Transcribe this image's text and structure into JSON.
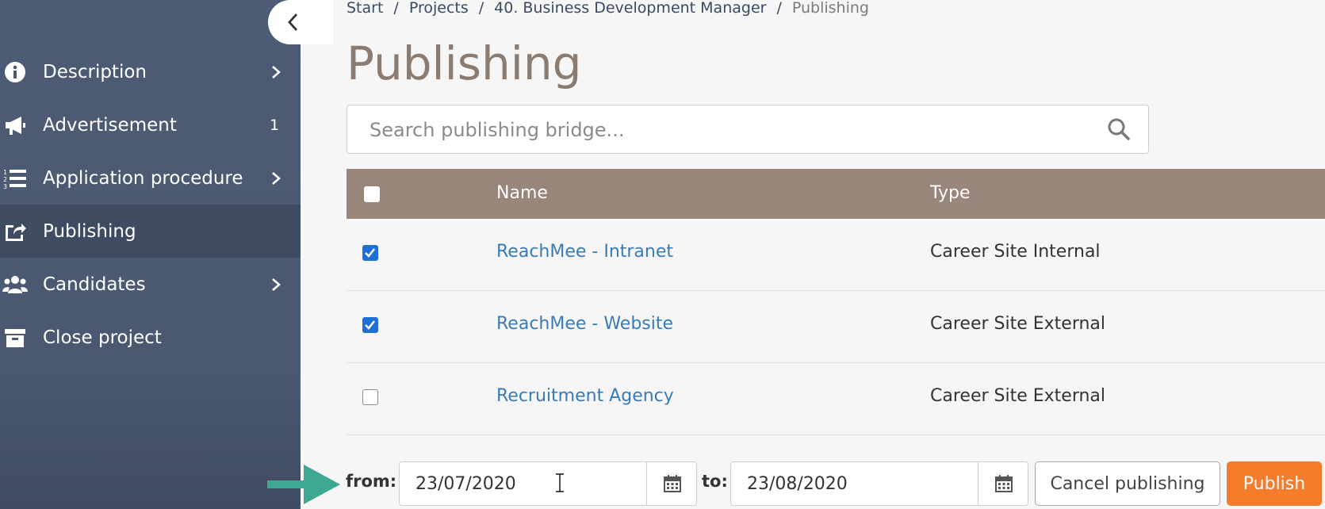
{
  "breadcrumb": {
    "items": [
      "Start",
      "Projects",
      "40. Business Development Manager",
      "Publishing"
    ],
    "separator": "/"
  },
  "page_title": "Publishing",
  "sidebar": {
    "items": [
      {
        "label": "Description",
        "icon": "info-circle-icon",
        "chevron": true
      },
      {
        "label": "Advertisement",
        "icon": "megaphone-icon",
        "badge": "1"
      },
      {
        "label": "Application procedure",
        "icon": "ordered-list-icon",
        "chevron": true
      },
      {
        "label": "Publishing",
        "icon": "share-square-icon",
        "active": true
      },
      {
        "label": "Candidates",
        "icon": "users-icon",
        "chevron": true
      },
      {
        "label": "Close project",
        "icon": "archive-box-icon"
      }
    ]
  },
  "search": {
    "placeholder": "Search publishing bridge..."
  },
  "table": {
    "columns": [
      "Name",
      "Type"
    ],
    "rows": [
      {
        "checked": true,
        "name": "ReachMee - Intranet",
        "type": "Career Site Internal"
      },
      {
        "checked": true,
        "name": "ReachMee - Website",
        "type": "Career Site External"
      },
      {
        "checked": false,
        "name": "Recruitment Agency",
        "type": "Career Site External"
      }
    ]
  },
  "publish_form": {
    "from_label": "from:",
    "from_value": "23/07/2020",
    "to_label": "to:",
    "to_value": "23/08/2020",
    "cancel_label": "Cancel publishing",
    "publish_label": "Publish"
  },
  "colors": {
    "sidebar": "#4a5871",
    "table_header": "#978679",
    "title": "#8c7b6f",
    "link": "#3a7bb6",
    "publish": "#f47c2a",
    "arrow": "#3fa893"
  }
}
